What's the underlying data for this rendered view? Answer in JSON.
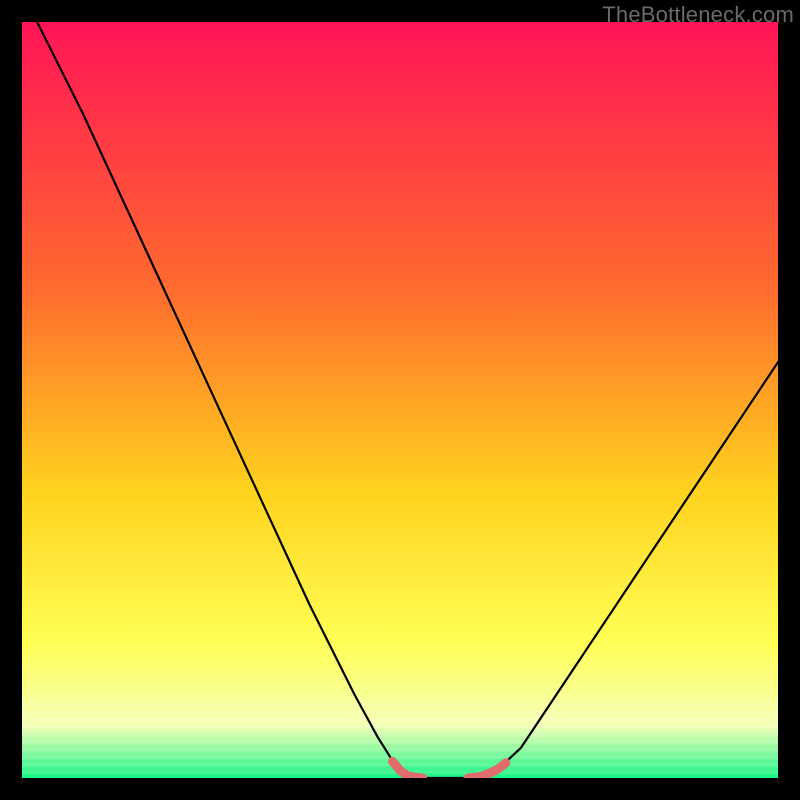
{
  "watermark": "TheBottleneck.com",
  "colors": {
    "gradient_top": "#ff1457",
    "gradient_mid1": "#ff6a2e",
    "gradient_mid2": "#ffd21e",
    "gradient_mid3": "#ffff55",
    "gradient_mid4": "#f5ffb5",
    "gradient_bottom": "#16f585",
    "curve": "#000000",
    "highlight": "#e06c6c"
  },
  "chart_data": {
    "type": "line",
    "title": "",
    "xlabel": "",
    "ylabel": "",
    "xlim": [
      0,
      100
    ],
    "ylim": [
      0,
      100
    ],
    "x": [
      2,
      5,
      8,
      11,
      14,
      17,
      20,
      23,
      26,
      29,
      32,
      35,
      38,
      41,
      44,
      47,
      49.5,
      51,
      53,
      55,
      57,
      59,
      61,
      63,
      66,
      69,
      72,
      75,
      78,
      81,
      84,
      87,
      90,
      93,
      96,
      100
    ],
    "values": [
      100,
      94,
      88,
      81.5,
      75,
      68.5,
      62,
      55.5,
      49,
      42.5,
      36,
      29.5,
      23,
      17,
      11,
      5.5,
      1.5,
      0.3,
      0.0,
      0.0,
      0.0,
      0.0,
      0.3,
      1.2,
      4,
      8.5,
      13,
      17.5,
      22,
      26.5,
      31,
      35.5,
      40,
      44.5,
      49,
      55
    ],
    "highlight_segments": [
      {
        "x": [
          49.0,
          50.0,
          51.0,
          52.0,
          53.0
        ],
        "y": [
          2.2,
          1.0,
          0.3,
          0.1,
          0.0
        ]
      },
      {
        "x": [
          59.0,
          60.0,
          61.0,
          62.0,
          63.0,
          64.0
        ],
        "y": [
          0.0,
          0.1,
          0.3,
          0.7,
          1.2,
          2.0
        ]
      }
    ]
  }
}
